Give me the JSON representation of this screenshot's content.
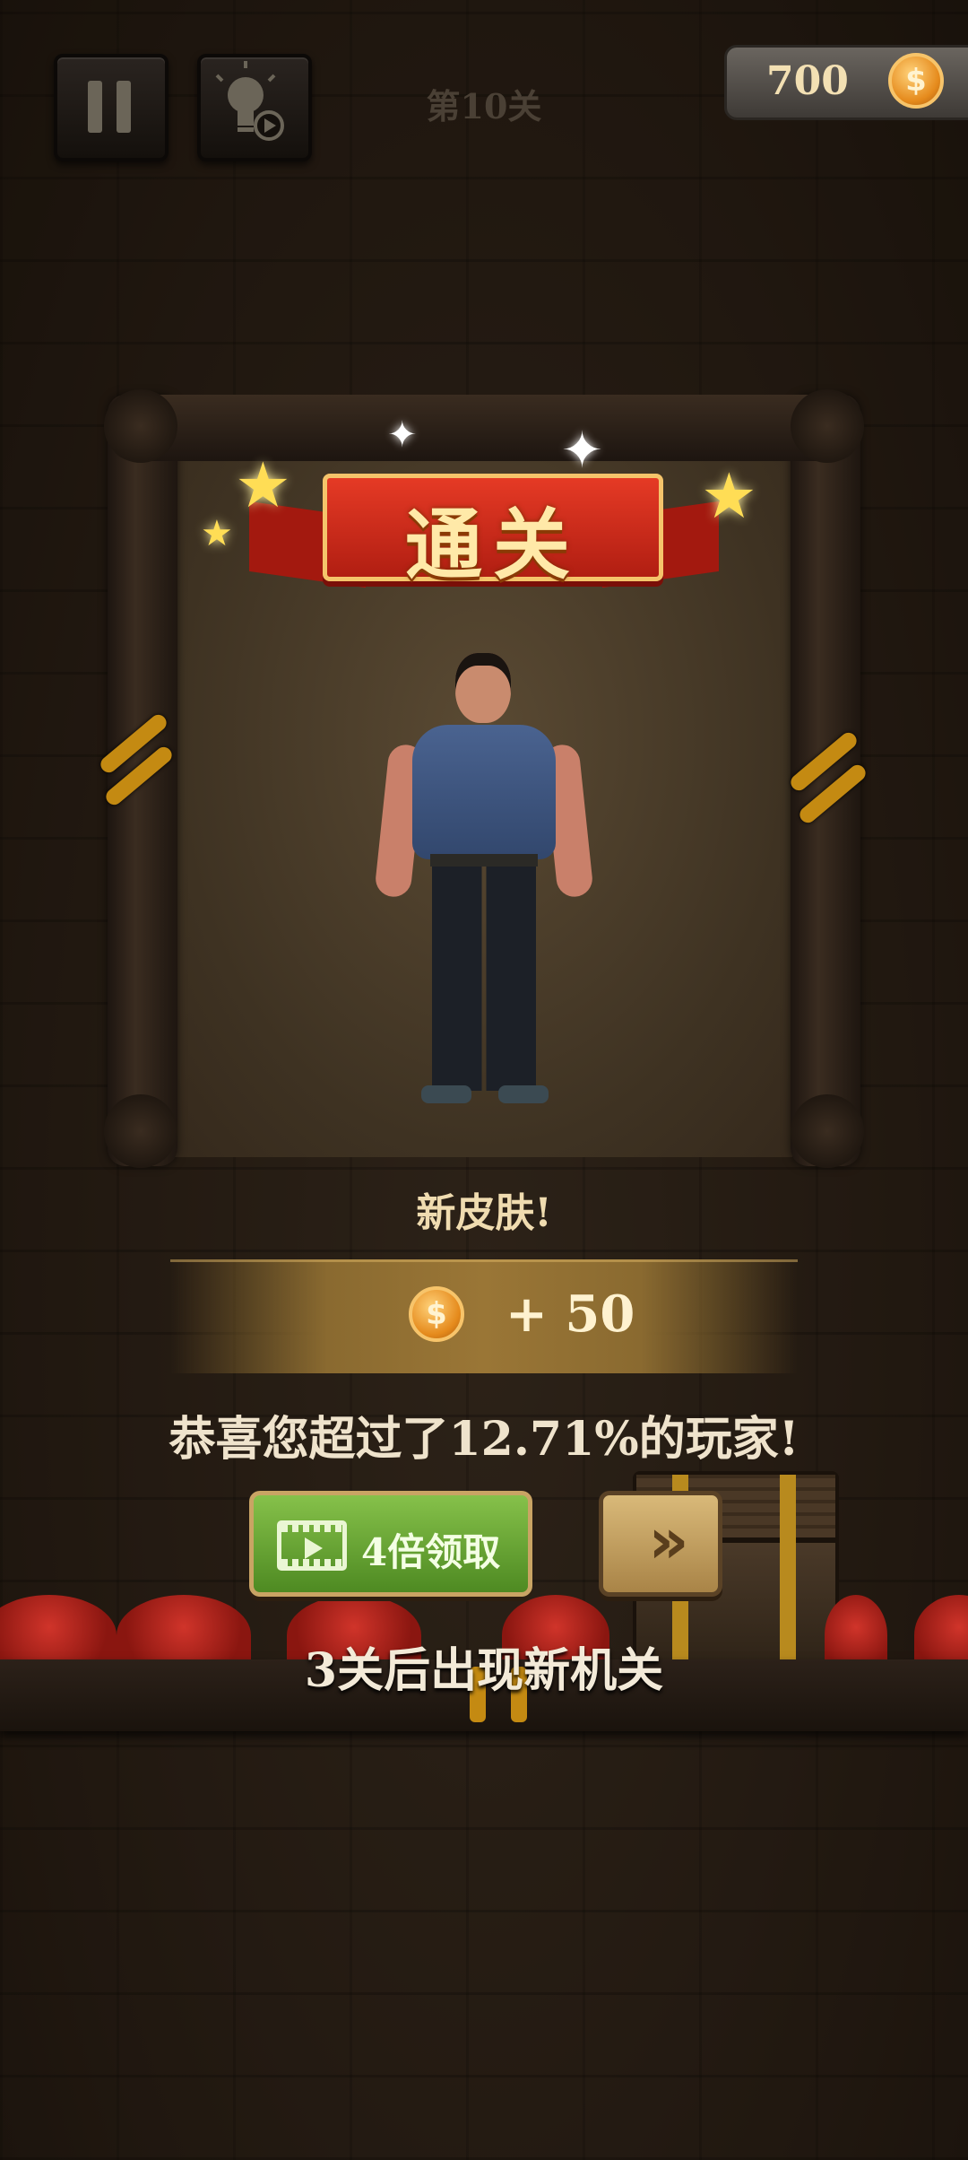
{
  "hud": {
    "level_title": "第10关",
    "coin_count": "700",
    "coin_symbol": "$"
  },
  "result": {
    "banner_text": "通关",
    "new_skin_text": "新皮肤!",
    "reward_text": "+ 50",
    "congrats_text": "恭喜您超过了12.71%的玩家!"
  },
  "actions": {
    "video_claim_label": "4倍领取",
    "next_icon": "»"
  },
  "footer": {
    "hint_text": "3关后出现新机关"
  },
  "icons": {
    "pause": "pause-icon",
    "hint": "lightbulb-video-icon",
    "coin": "coin-icon",
    "film": "film-play-icon",
    "next": "double-chevron-icon"
  },
  "colors": {
    "ribbon_red": "#c42518",
    "button_green": "#6aa836",
    "button_gold": "#c9a464",
    "coin_orange": "#e58a1c"
  }
}
